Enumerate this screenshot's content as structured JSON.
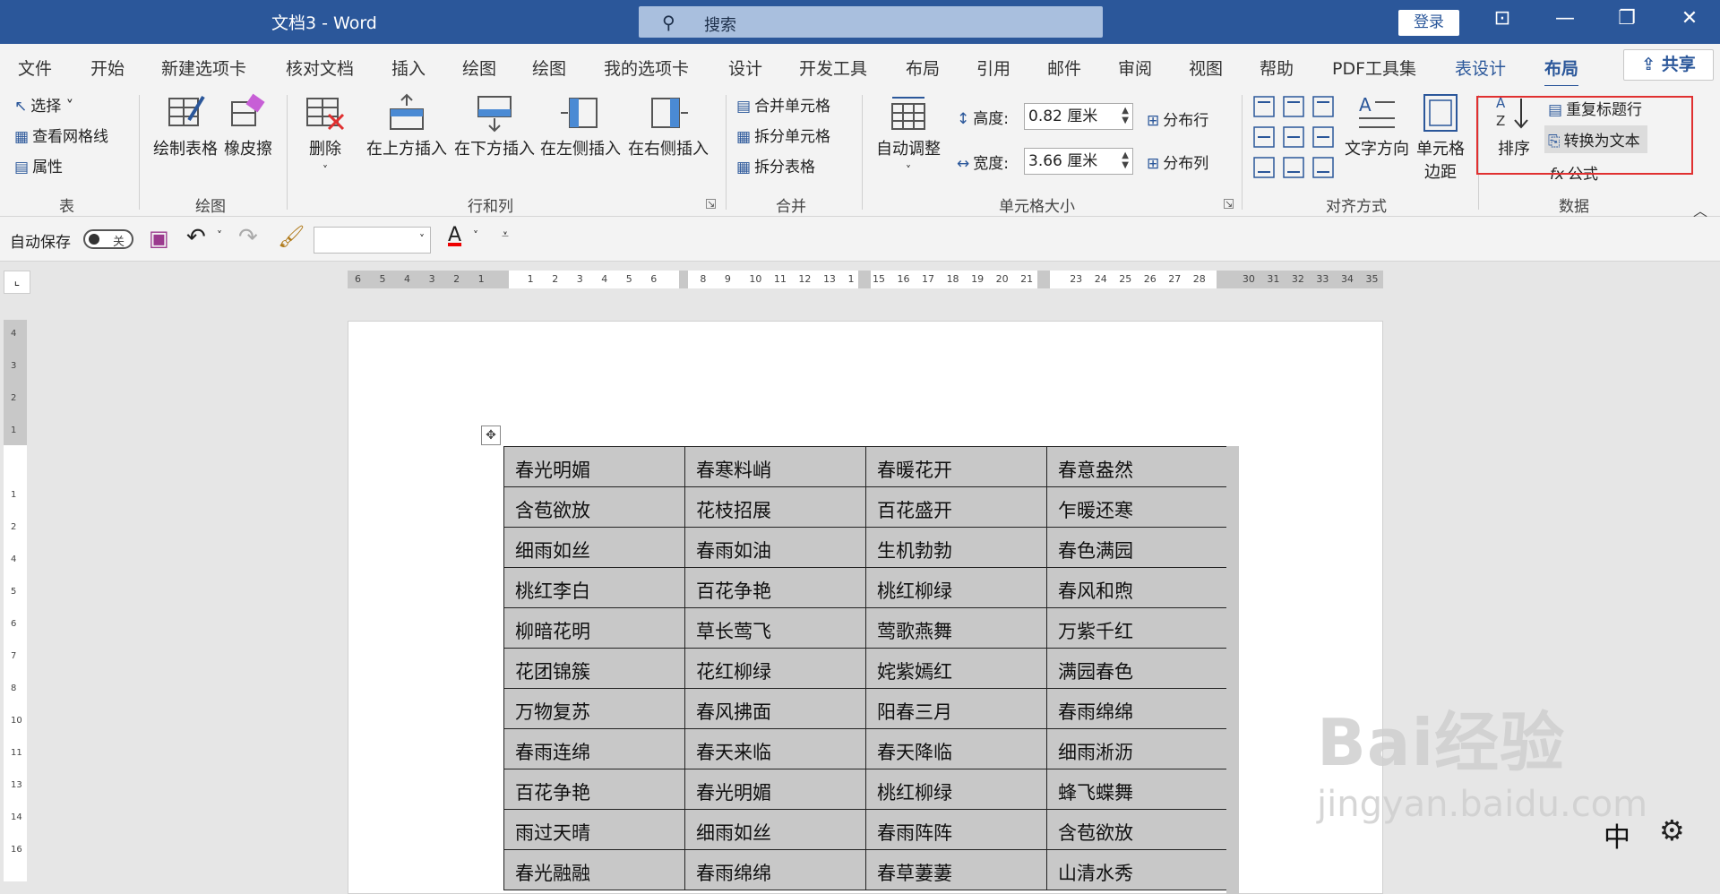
{
  "title_bar": {
    "title": "文档3  -  Word",
    "search_placeholder": "搜索",
    "login": "登录",
    "buttons": [
      "⊡",
      "—",
      "❐",
      "✕"
    ]
  },
  "tabs": [
    "文件",
    "开始",
    "新建选项卡",
    "核对文档",
    "插入",
    "绘图",
    "绘图",
    "我的选项卡",
    "设计",
    "开发工具",
    "布局",
    "引用",
    "邮件",
    "审阅",
    "视图",
    "帮助",
    "PDF工具集",
    "表设计",
    "布局"
  ],
  "share_label": "共享",
  "ribbon": {
    "table_group": {
      "label": "表",
      "select": "选择",
      "gridlines": "查看网格线",
      "properties": "属性"
    },
    "draw_group": {
      "label": "绘图",
      "draw_table": "绘制表格",
      "eraser": "橡皮擦"
    },
    "rowcol_group": {
      "label": "行和列",
      "delete": "删除",
      "insert_above": "在上方插入",
      "insert_below": "在下方插入",
      "insert_left": "在左侧插入",
      "insert_right": "在右侧插入"
    },
    "merge_group": {
      "label": "合并",
      "merge_cells": "合并单元格",
      "split_cells": "拆分单元格",
      "split_table": "拆分表格"
    },
    "cellsize_group": {
      "label": "单元格大小",
      "autofit": "自动调整",
      "height_label": "高度:",
      "height_value": "0.82 厘米",
      "width_label": "宽度:",
      "width_value": "3.66 厘米",
      "distribute_rows": "分布行",
      "distribute_cols": "分布列"
    },
    "align_group": {
      "label": "对齐方式",
      "text_direction": "文字方向",
      "cell_margins_1": "单元格",
      "cell_margins_2": "边距"
    },
    "data_group": {
      "label": "数据",
      "sort": "排序",
      "repeat_header": "重复标题行",
      "convert_to_text": "转换为文本",
      "formula": "公式"
    }
  },
  "qat": {
    "autosave": "自动保存",
    "toggle_state": "关"
  },
  "ruler_top": [
    "6",
    "5",
    "4",
    "3",
    "2",
    "1",
    "",
    "1",
    "2",
    "3",
    "4",
    "5",
    "6",
    "",
    "8",
    "9",
    "10",
    "11",
    "12",
    "13",
    "1",
    "15",
    "16",
    "17",
    "18",
    "19",
    "20",
    "21",
    "",
    "23",
    "24",
    "25",
    "26",
    "27",
    "28",
    "",
    "30",
    "31",
    "32",
    "33",
    "34",
    "35"
  ],
  "ruler_left": [
    "4",
    "3",
    "2",
    "1",
    "",
    "1",
    "2",
    "4",
    "5",
    "6",
    "7",
    "8",
    "10",
    "11",
    "13",
    "14",
    "16"
  ],
  "table": [
    [
      "春光明媚",
      "春寒料峭",
      "春暖花开",
      "春意盎然"
    ],
    [
      "含苞欲放",
      "花枝招展",
      "百花盛开",
      "乍暖还寒"
    ],
    [
      "细雨如丝",
      "春雨如油",
      "生机勃勃",
      "春色满园"
    ],
    [
      "桃红李白",
      "百花争艳",
      "桃红柳绿",
      "春风和煦"
    ],
    [
      "柳暗花明",
      "草长莺飞",
      "莺歌燕舞",
      "万紫千红"
    ],
    [
      "花团锦簇",
      "花红柳绿",
      "姹紫嫣红",
      "满园春色"
    ],
    [
      "万物复苏",
      "春风拂面",
      "阳春三月",
      "春雨绵绵"
    ],
    [
      "春雨连绵",
      "春天来临",
      "春天降临",
      "细雨淅沥"
    ],
    [
      "百花争艳",
      "春光明媚",
      "桃红柳绿",
      "蜂飞蝶舞"
    ],
    [
      "雨过天晴",
      "细雨如丝",
      "春雨阵阵",
      "含苞欲放"
    ],
    [
      "春光融融",
      "春雨绵绵",
      "春草萋萋",
      "山清水秀"
    ]
  ],
  "watermark": {
    "line1": "Bai经验",
    "line2": "jingyan.baidu.com"
  },
  "ime": "中"
}
